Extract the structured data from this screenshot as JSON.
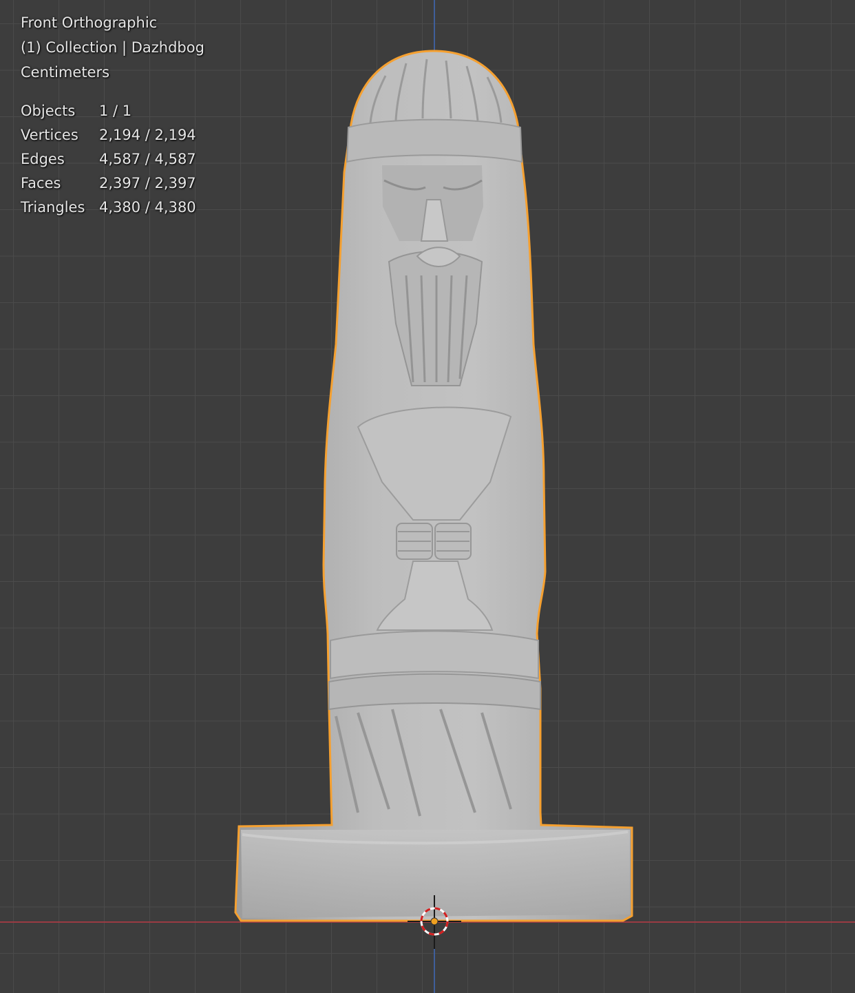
{
  "viewport": {
    "view_name": "Front Orthographic",
    "collection_line": "(1) Collection | Dazhdbog",
    "units": "Centimeters"
  },
  "stats": [
    {
      "label": "Objects",
      "value": "1 / 1"
    },
    {
      "label": "Vertices",
      "value": "2,194 / 2,194"
    },
    {
      "label": "Edges",
      "value": "4,587 / 4,587"
    },
    {
      "label": "Faces",
      "value": "2,397 / 2,397"
    },
    {
      "label": "Triangles",
      "value": "4,380 / 4,380"
    }
  ],
  "colors": {
    "background": "#3d3d3d",
    "grid": "#4b4b4b",
    "x_axis": "#9b3b43",
    "z_axis": "#3f5f9a",
    "selection_outline": "#f5a030",
    "mesh": "#b4b4b4"
  }
}
